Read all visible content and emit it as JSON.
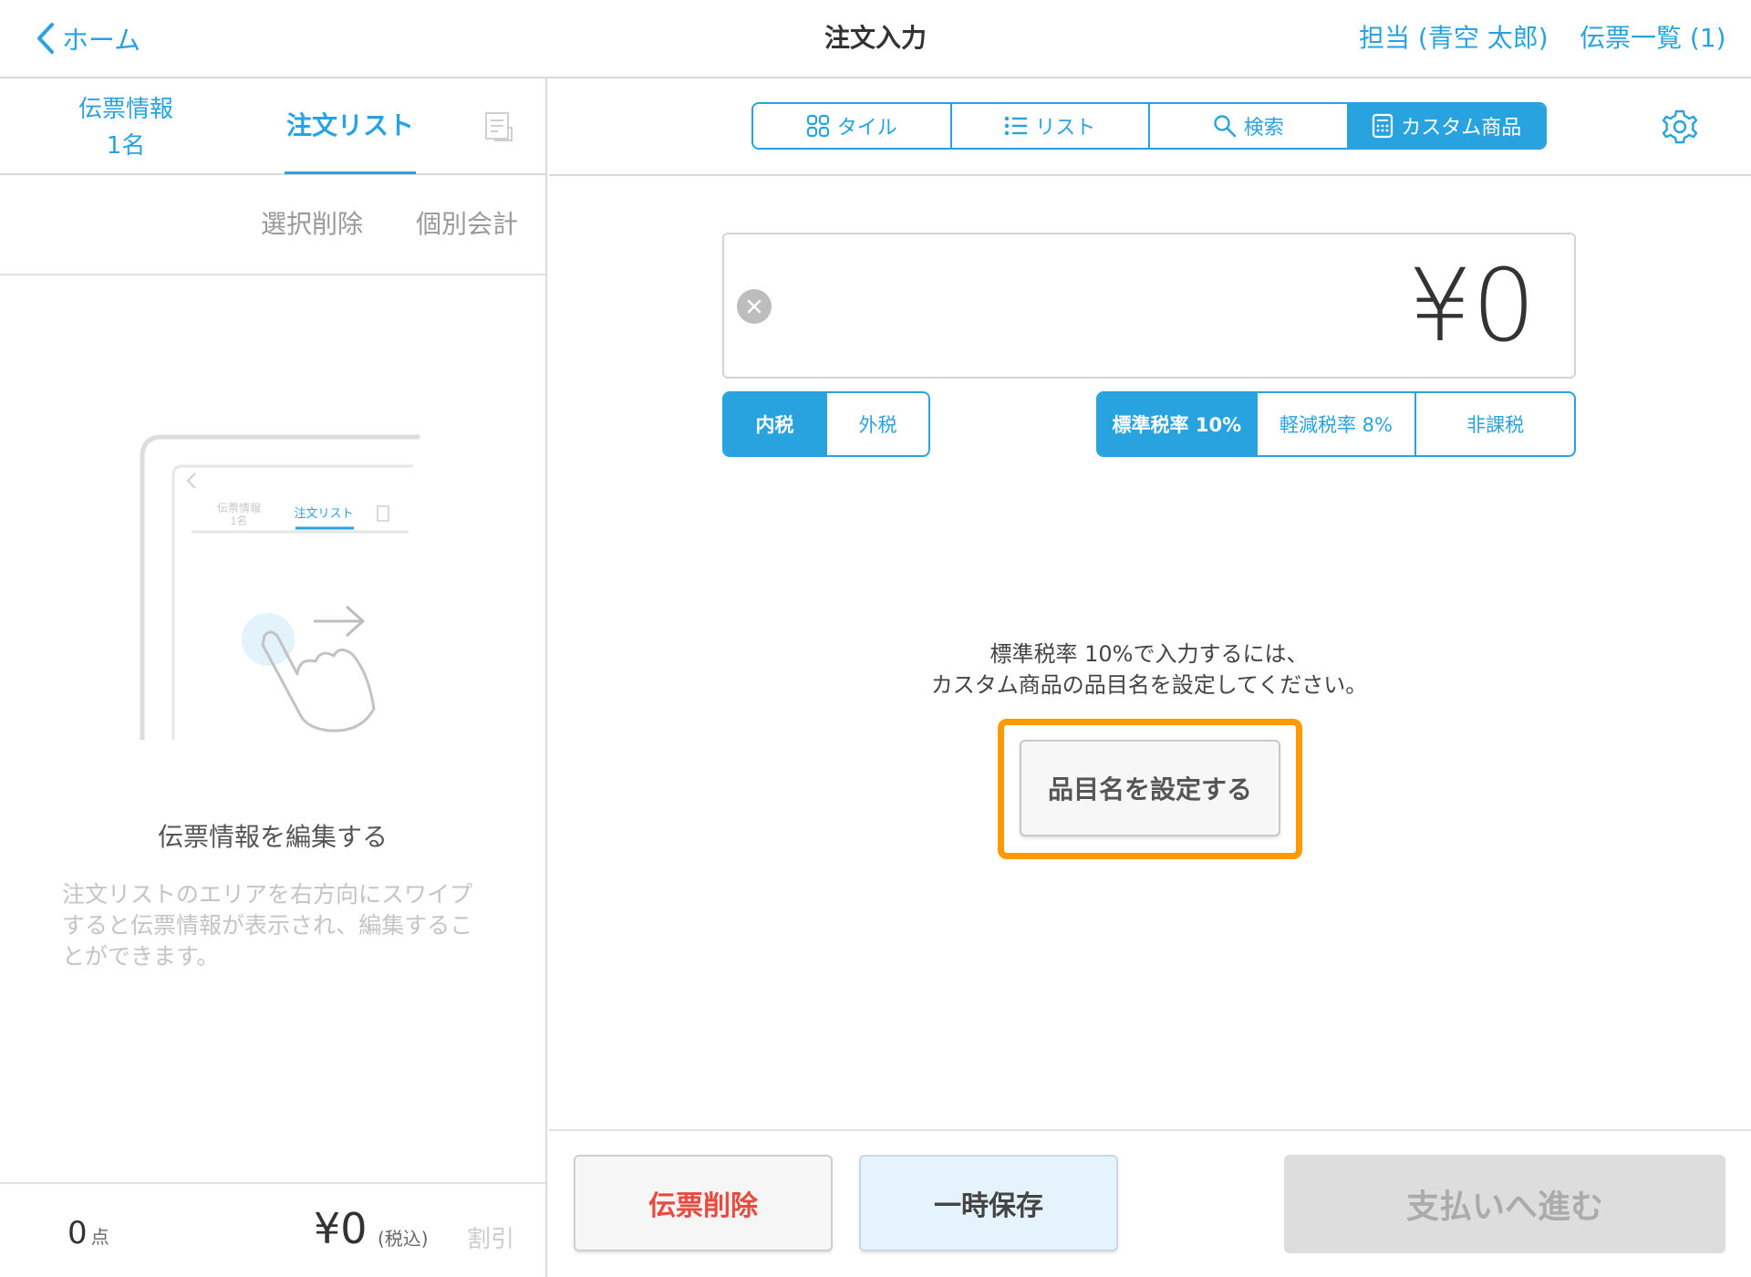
{
  "header": {
    "back_label": "ホーム",
    "title": "注文入力",
    "staff": "担当 (青空 太郎)",
    "slips": "伝票一覧 (1)"
  },
  "left": {
    "tab_info_line1": "伝票情報",
    "tab_info_line2": "1名",
    "tab_order": "注文リスト",
    "delete_selected": "選択削除",
    "split_bill": "個別会計",
    "illust": {
      "tab_info_line1": "伝票情報",
      "tab_info_line2": "1名",
      "tab_order": "注文リスト"
    },
    "hint_title": "伝票情報を編集する",
    "hint_body": "注文リストのエリアを右方向にスワイプすると伝票情報が表示され、編集することができます。",
    "footer": {
      "count": "0",
      "count_unit": "点",
      "total": "¥0",
      "tax_note": "(税込)",
      "discount": "割引"
    }
  },
  "right": {
    "view_modes": [
      "タイル",
      "リスト",
      "検索",
      "カスタム商品"
    ],
    "active_view": "カスタム商品",
    "price": "¥0",
    "tax_inclusion": [
      "内税",
      "外税"
    ],
    "tax_inclusion_active": "内税",
    "tax_rates": [
      "標準税率 10%",
      "軽減税率 8%",
      "非課税"
    ],
    "tax_rate_active": "標準税率 10%",
    "notice_line1": "標準税率 10%で入力するには、",
    "notice_line2": "カスタム商品の品目名を設定してください。",
    "set_name_button": "品目名を設定する",
    "delete_slip_button": "伝票削除",
    "hold_button": "一時保存",
    "pay_button": "支払いへ進む"
  },
  "colors": {
    "accent": "#29a3e0",
    "highlight": "#ff9900",
    "danger": "#e94a3f"
  },
  "icons": [
    "chevron-left-icon",
    "document-icon",
    "tile-icon",
    "list-icon",
    "search-icon",
    "calculator-icon",
    "gear-icon",
    "clear-icon",
    "swipe-hand-icon"
  ]
}
